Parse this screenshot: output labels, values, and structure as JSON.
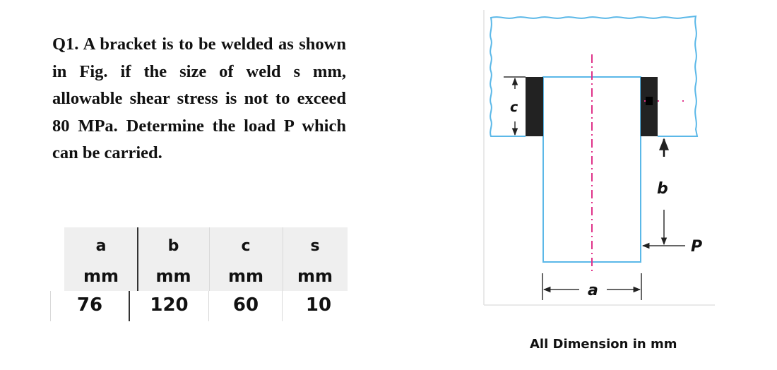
{
  "question": {
    "text": "Q1. A bracket is to be welded as shown in Fig. if the size of weld s mm, allowable shear stress is not to exceed 80 MPa. Determine the load P which can be carried."
  },
  "table": {
    "headers": [
      {
        "symbol": "a",
        "unit": "mm"
      },
      {
        "symbol": "b",
        "unit": "mm"
      },
      {
        "symbol": "c",
        "unit": "mm"
      },
      {
        "symbol": "s",
        "unit": "mm"
      }
    ],
    "values": [
      "76",
      "120",
      "60",
      "10"
    ]
  },
  "figure": {
    "labels": {
      "c": "c",
      "b": "b",
      "a": "a",
      "P": "P"
    },
    "colors": {
      "outline": "#5bb8e8",
      "centerline": "#e0338a",
      "weld": "#222222",
      "dimension": "#333333"
    },
    "caption": "All Dimension in mm"
  }
}
